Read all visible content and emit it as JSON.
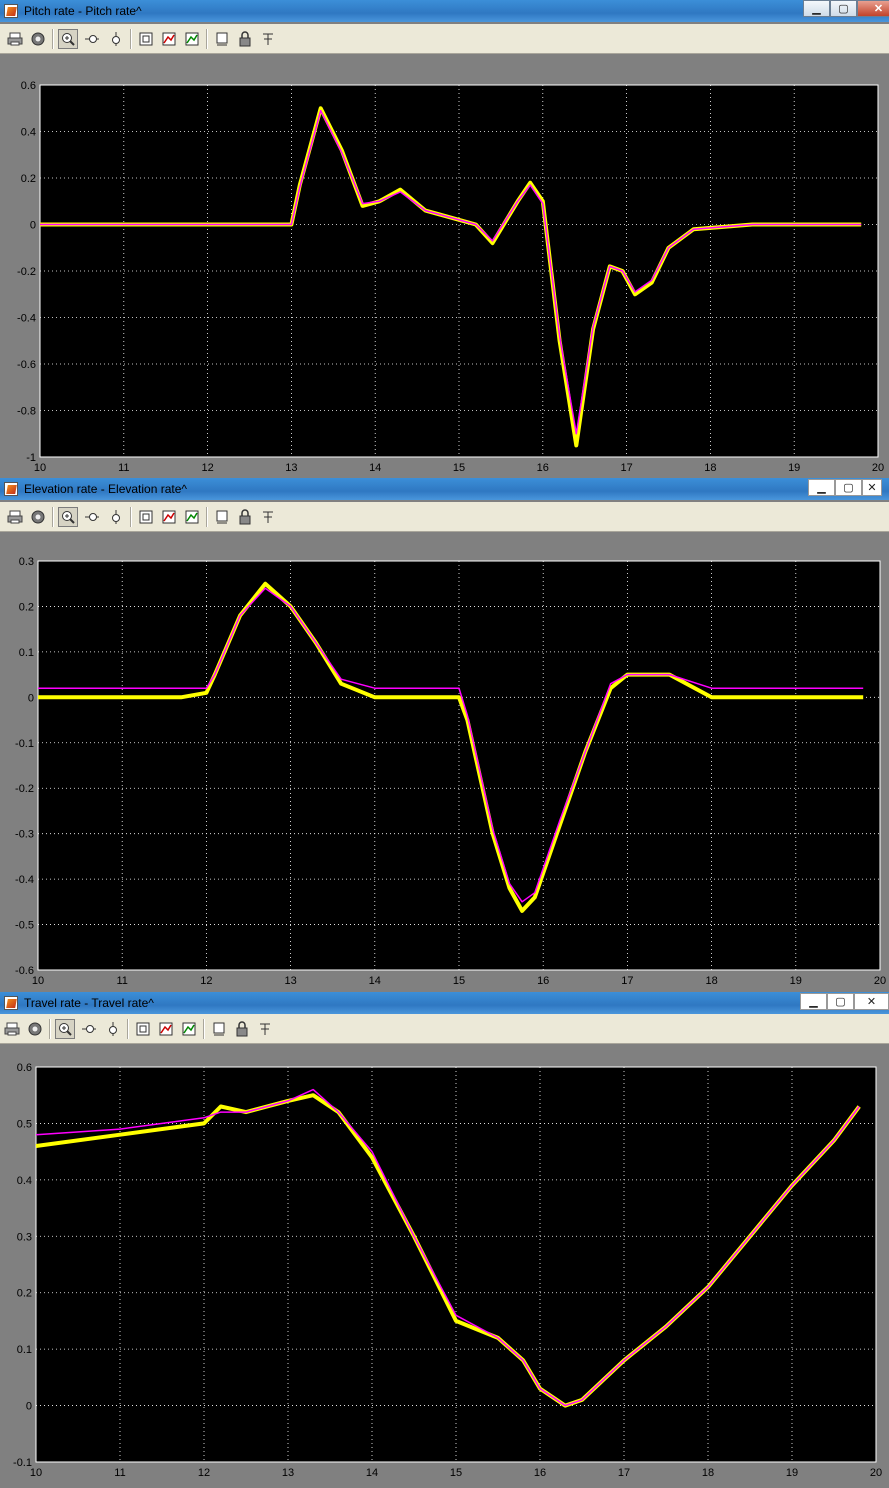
{
  "windows": [
    {
      "id": "pitch",
      "title": "Pitch rate - Pitch rate^",
      "active": true,
      "chart_data": {
        "type": "line",
        "title": "",
        "xlabel": "",
        "ylabel": "",
        "xlim": [
          10,
          20
        ],
        "ylim": [
          -1,
          0.6
        ],
        "xticks": [
          10,
          11,
          12,
          13,
          14,
          15,
          16,
          17,
          18,
          19,
          20
        ],
        "yticks": [
          -1,
          -0.8,
          -0.6,
          -0.4,
          -0.2,
          0,
          0.2,
          0.4,
          0.6
        ],
        "grid": true,
        "series": [
          {
            "color": "#ffff00",
            "x": [
              10.0,
              11.0,
              12.0,
              13.0,
              13.1,
              13.35,
              13.6,
              13.85,
              14.05,
              14.3,
              14.6,
              14.8,
              15.2,
              15.4,
              15.7,
              15.85,
              16.0,
              16.2,
              16.4,
              16.6,
              16.8,
              16.95,
              17.1,
              17.3,
              17.5,
              17.8,
              18.5,
              19.0,
              19.8
            ],
            "y": [
              0.0,
              0.0,
              0.0,
              0.0,
              0.17,
              0.5,
              0.32,
              0.08,
              0.1,
              0.15,
              0.06,
              0.04,
              0.0,
              -0.08,
              0.1,
              0.18,
              0.1,
              -0.5,
              -0.95,
              -0.45,
              -0.18,
              -0.2,
              -0.3,
              -0.25,
              -0.1,
              -0.02,
              0.0,
              0.0,
              0.0
            ]
          },
          {
            "color": "#ff00ff",
            "x": [
              10.0,
              11.0,
              12.0,
              13.0,
              13.1,
              13.35,
              13.6,
              13.85,
              14.05,
              14.3,
              14.6,
              14.8,
              15.2,
              15.4,
              15.7,
              15.85,
              16.0,
              16.2,
              16.4,
              16.6,
              16.8,
              16.95,
              17.1,
              17.3,
              17.5,
              17.8,
              18.5,
              19.0,
              19.8
            ],
            "y": [
              0.0,
              0.0,
              0.0,
              0.0,
              0.16,
              0.49,
              0.31,
              0.09,
              0.1,
              0.14,
              0.06,
              0.04,
              0.0,
              -0.07,
              0.1,
              0.17,
              0.09,
              -0.48,
              -0.9,
              -0.44,
              -0.18,
              -0.2,
              -0.29,
              -0.24,
              -0.1,
              -0.02,
              0.0,
              0.0,
              0.0
            ]
          }
        ]
      }
    },
    {
      "id": "elevation",
      "title": "Elevation rate - Elevation rate^",
      "active": false,
      "chart_data": {
        "type": "line",
        "title": "",
        "xlabel": "",
        "ylabel": "",
        "xlim": [
          10,
          20
        ],
        "ylim": [
          -0.6,
          0.3
        ],
        "xticks": [
          10,
          11,
          12,
          13,
          14,
          15,
          16,
          17,
          18,
          19,
          20
        ],
        "yticks": [
          -0.6,
          -0.5,
          -0.4,
          -0.3,
          -0.2,
          -0.1,
          0,
          0.1,
          0.2,
          0.3
        ],
        "grid": true,
        "series": [
          {
            "color": "#ffff00",
            "x": [
              10.0,
              11.0,
              11.7,
              12.0,
              12.1,
              12.4,
              12.7,
              13.0,
              13.3,
              13.6,
              14.0,
              15.0,
              15.1,
              15.4,
              15.6,
              15.75,
              15.9,
              16.2,
              16.5,
              16.8,
              17.0,
              17.5,
              18.0,
              19.0,
              19.8
            ],
            "y": [
              0.0,
              0.0,
              0.0,
              0.01,
              0.05,
              0.18,
              0.25,
              0.2,
              0.12,
              0.03,
              0.0,
              0.0,
              -0.05,
              -0.3,
              -0.42,
              -0.47,
              -0.44,
              -0.28,
              -0.12,
              0.02,
              0.05,
              0.05,
              0.0,
              0.0,
              0.0
            ]
          },
          {
            "color": "#ff00ff",
            "x": [
              10.0,
              11.0,
              11.7,
              12.0,
              12.1,
              12.4,
              12.7,
              13.0,
              13.3,
              13.6,
              14.0,
              15.0,
              15.1,
              15.4,
              15.6,
              15.75,
              15.9,
              16.2,
              16.5,
              16.8,
              17.0,
              17.5,
              18.0,
              19.0,
              19.8
            ],
            "y": [
              0.02,
              0.02,
              0.02,
              0.02,
              0.05,
              0.18,
              0.24,
              0.2,
              0.12,
              0.04,
              0.02,
              0.02,
              -0.04,
              -0.29,
              -0.41,
              -0.45,
              -0.43,
              -0.27,
              -0.12,
              0.03,
              0.05,
              0.05,
              0.02,
              0.02,
              0.02
            ]
          }
        ]
      }
    },
    {
      "id": "travel",
      "title": "Travel rate - Travel rate^",
      "active": false,
      "chart_data": {
        "type": "line",
        "title": "",
        "xlabel": "",
        "ylabel": "",
        "xlim": [
          10,
          20
        ],
        "ylim": [
          -0.1,
          0.6
        ],
        "xticks": [
          10,
          11,
          12,
          13,
          14,
          15,
          16,
          17,
          18,
          19,
          20
        ],
        "yticks": [
          -0.1,
          0,
          0.1,
          0.2,
          0.3,
          0.4,
          0.5,
          0.6
        ],
        "grid": true,
        "series": [
          {
            "color": "#ffff00",
            "x": [
              10.0,
              11.0,
              12.0,
              12.2,
              12.5,
              13.0,
              13.3,
              13.6,
              14.0,
              14.5,
              15.0,
              15.5,
              15.8,
              16.0,
              16.3,
              16.5,
              17.0,
              17.5,
              18.0,
              18.5,
              19.0,
              19.5,
              19.8
            ],
            "y": [
              0.46,
              0.48,
              0.5,
              0.53,
              0.52,
              0.54,
              0.55,
              0.52,
              0.44,
              0.3,
              0.15,
              0.12,
              0.08,
              0.03,
              0.0,
              0.01,
              0.08,
              0.14,
              0.21,
              0.3,
              0.39,
              0.47,
              0.53
            ]
          },
          {
            "color": "#ff00ff",
            "x": [
              10.0,
              11.0,
              12.0,
              12.2,
              12.5,
              13.0,
              13.3,
              13.6,
              14.0,
              14.5,
              15.0,
              15.5,
              15.8,
              16.0,
              16.3,
              16.5,
              17.0,
              17.5,
              18.0,
              18.5,
              19.0,
              19.5,
              19.8
            ],
            "y": [
              0.48,
              0.49,
              0.51,
              0.52,
              0.52,
              0.54,
              0.56,
              0.52,
              0.45,
              0.3,
              0.16,
              0.12,
              0.08,
              0.03,
              0.0,
              0.01,
              0.08,
              0.14,
              0.21,
              0.3,
              0.39,
              0.47,
              0.53
            ]
          }
        ]
      }
    }
  ],
  "icons": [
    "print-icon",
    "parameters-icon",
    "zoom-in-icon",
    "zoom-x-icon",
    "zoom-y-icon",
    "autoscale-icon",
    "save-axes-icon",
    "restore-axes-icon",
    "float-icon",
    "lock-icon",
    "signal-select-icon"
  ]
}
